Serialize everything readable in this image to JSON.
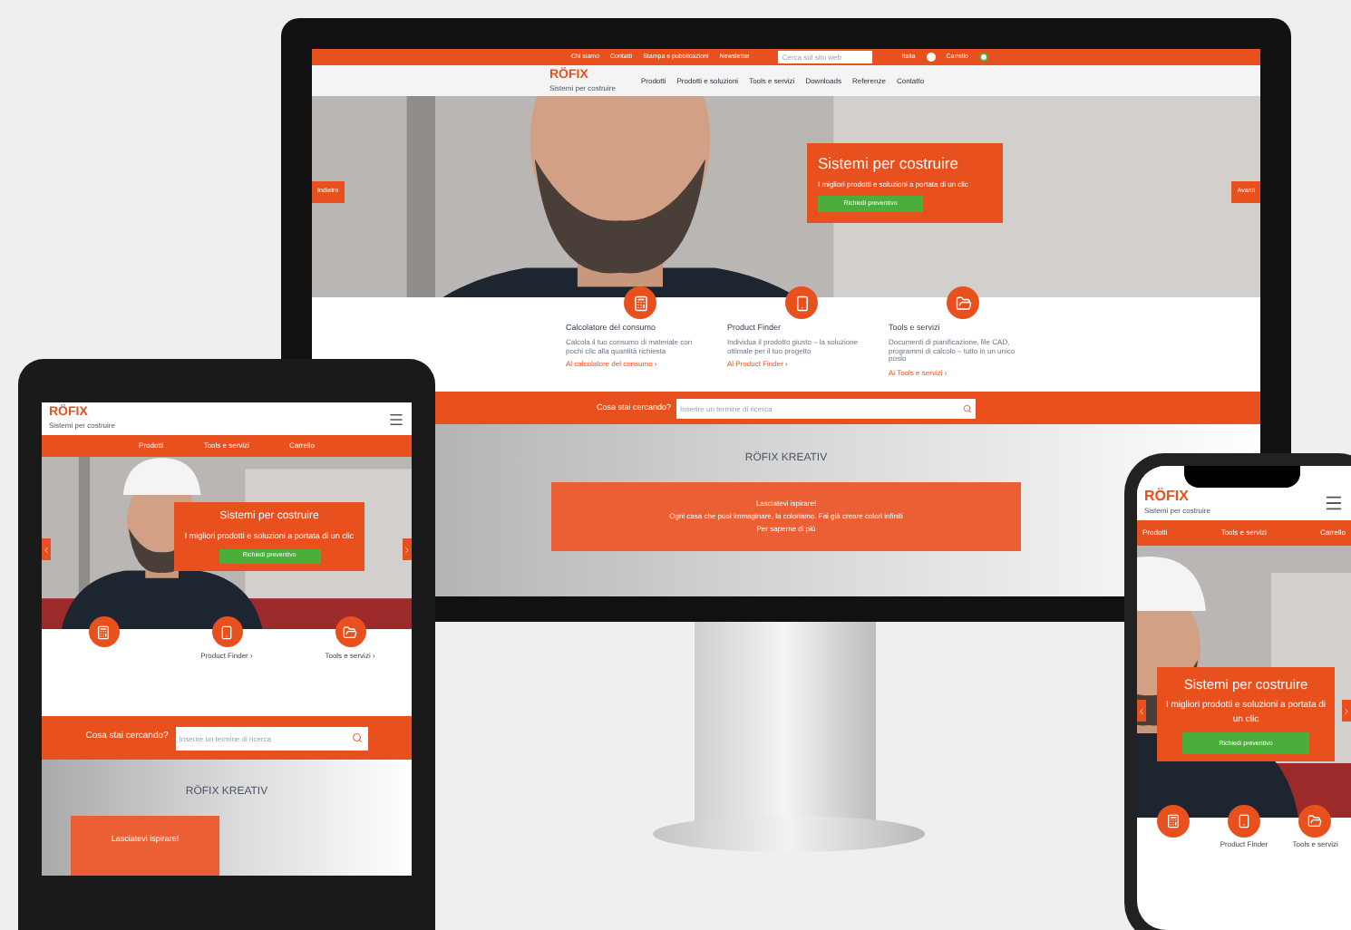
{
  "monitor": {
    "top_links": [
      "Chi siamo",
      "Contatti",
      "Stampa e pubblicazioni",
      "Newsletter"
    ],
    "top_search": {
      "placeholder": "Cerca sul sito web"
    },
    "language": "Italia",
    "cart": "Carrello",
    "logo": "RÖFIX",
    "tagline": "Sistemi per costruire",
    "nav": [
      "Prodotti",
      "Prodotti e soluzioni",
      "Tools e servizi",
      "Downloads",
      "Referenze",
      "Contatto"
    ],
    "hero": {
      "prev": "Indietro",
      "next": "Avanti",
      "title": "Sistemi per costruire",
      "subtitle": "I migliori prodotti e soluzioni a portata di un clic",
      "button": "Richiedi preventivo"
    },
    "features": [
      {
        "title": "Calcolatore del consumo",
        "text": "Calcola il tuo consumo di materiale con pochi clic alla quantità richiesta",
        "link": "Al calcolatore del consumo ›"
      },
      {
        "title": "Product Finder",
        "text": "Individua il prodotto giusto – la soluzione ottimale per il tuo progetto",
        "link": "Al Product Finder ›"
      },
      {
        "title": "Tools e servizi",
        "text": "Documenti di pianificazione, file CAD, programmi di calcolo – tutto in un unico posto",
        "link": "Ai Tools e servizi ›"
      }
    ],
    "search": {
      "label": "Cosa stai cercando?",
      "placeholder": "Inserire un termine di ricerca"
    },
    "kreativ": {
      "title": "RÖFIX KREATIV",
      "heading": "Lasciatevi ispirare!",
      "text": "Ogni casa che puoi immaginare, la coloriamo. Fai già creare colori infiniti",
      "link": "Per saperne di più"
    }
  },
  "tablet": {
    "logo": "RÖFIX",
    "tagline": "Sistemi per costruire",
    "nav": [
      "Prodotti",
      "Tools e servizi",
      "Carrello"
    ],
    "hero": {
      "title": "Sistemi per costruire",
      "subtitle": "I migliori prodotti e soluzioni a portata di un clic",
      "button": "Richiedi preventivo"
    },
    "features": [
      {
        "kind": "calculator"
      },
      {
        "kind": "phone",
        "label": "Product Finder ›"
      },
      {
        "kind": "folder",
        "label": "Tools e servizi ›"
      }
    ],
    "search": {
      "label": "Cosa stai cercando?",
      "placeholder": "Inserire un termine di ricerca"
    },
    "kreativ": {
      "title": "RÖFIX KREATIV",
      "heading": "Lasciatevi ispirare!"
    }
  },
  "phone": {
    "logo": "RÖFIX",
    "tagline": "Sistemi per costruire",
    "nav": [
      "Prodotti",
      "Tools e servizi",
      "Carrello"
    ],
    "hero": {
      "title": "Sistemi per costruire",
      "subtitle": "I migliori prodotti e soluzioni a portata di un clic",
      "button": "Richiedi preventivo"
    },
    "features": [
      {
        "kind": "calculator"
      },
      {
        "kind": "phone",
        "label": "Product Finder"
      },
      {
        "kind": "folder",
        "label": "Tools e servizi"
      }
    ]
  }
}
